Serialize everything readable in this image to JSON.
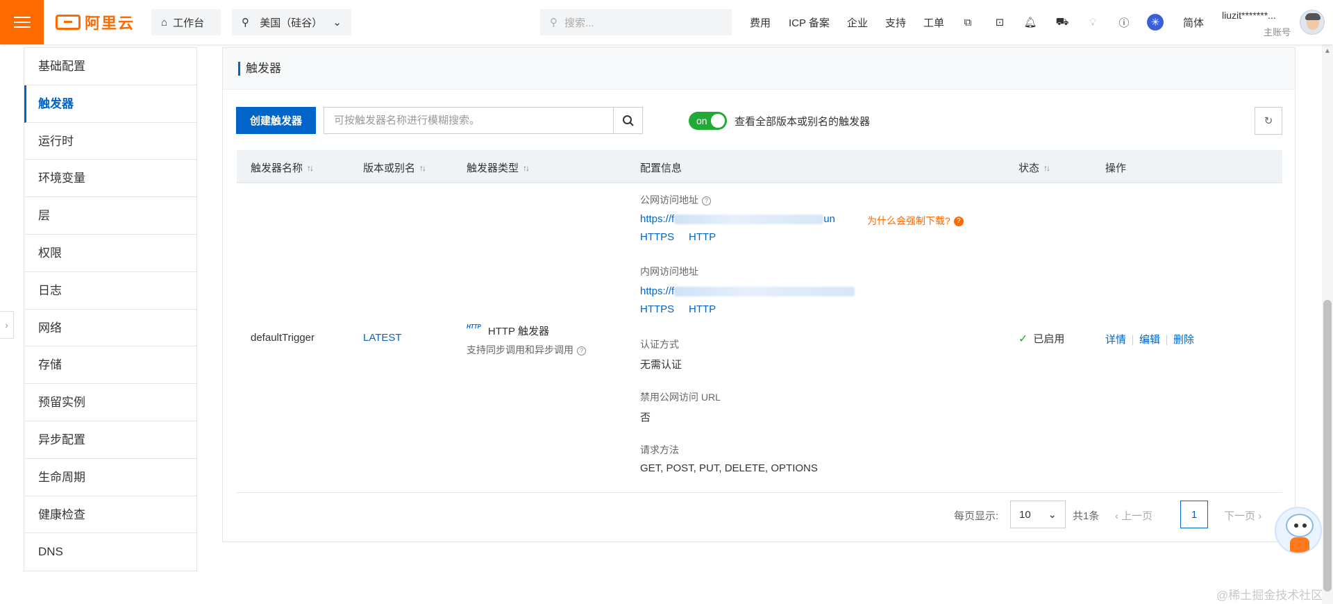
{
  "topbar": {
    "logo_text": "阿里云",
    "workbench": "工作台",
    "region": "美国（硅谷）",
    "search_placeholder": "搜索...",
    "nav": [
      "费用",
      "ICP 备案",
      "企业",
      "支持",
      "工单"
    ],
    "language": "简体",
    "user_name": "liuzit*******...",
    "user_role": "主账号",
    "brand_color": "#ff6a00"
  },
  "sidebar": {
    "items": [
      {
        "label": "基础配置"
      },
      {
        "label": "触发器"
      },
      {
        "label": "运行时"
      },
      {
        "label": "环境变量"
      },
      {
        "label": "层"
      },
      {
        "label": "权限"
      },
      {
        "label": "日志"
      },
      {
        "label": "网络"
      },
      {
        "label": "存储"
      },
      {
        "label": "预留实例"
      },
      {
        "label": "异步配置"
      },
      {
        "label": "生命周期"
      },
      {
        "label": "健康检查"
      },
      {
        "label": "DNS"
      }
    ],
    "active": "触发器"
  },
  "panel": {
    "title": "触发器",
    "create_button": "创建触发器",
    "search_placeholder": "可按触发器名称进行模糊搜索。",
    "toggle_label": "on",
    "toggle_description": "查看全部版本或别名的触发器",
    "accent_color": "#0064c8"
  },
  "table": {
    "headers": [
      "触发器名称",
      "版本或别名",
      "触发器类型",
      "配置信息",
      "状态",
      "操作"
    ],
    "row": {
      "name": "defaultTrigger",
      "version": "LATEST",
      "type_tag": "HTTP",
      "type": "HTTP 触发器",
      "type_desc": "支持同步调用和异步调用",
      "public_label": "公网访问地址",
      "public_url_prefix": "https://f",
      "public_url_suffix": "un",
      "why_download": "为什么会强制下载?",
      "public_https": "HTTPS",
      "public_http": "HTTP",
      "internal_label": "内网访问地址",
      "internal_url_prefix": "https://f",
      "internal_https": "HTTPS",
      "internal_http": "HTTP",
      "auth_label": "认证方式",
      "auth_value": "无需认证",
      "disable_label": "禁用公网访问 URL",
      "disable_value": "否",
      "method_label": "请求方法",
      "method_value": "GET, POST, PUT, DELETE, OPTIONS",
      "status": "已启用",
      "actions": [
        "详情",
        "编辑",
        "删除"
      ]
    }
  },
  "pagination": {
    "per_page_label": "每页显示:",
    "per_page": "10",
    "total": "共1条",
    "prev": "上一页",
    "current": "1",
    "next": "下一页"
  },
  "watermark": "@稀土掘金技术社区"
}
